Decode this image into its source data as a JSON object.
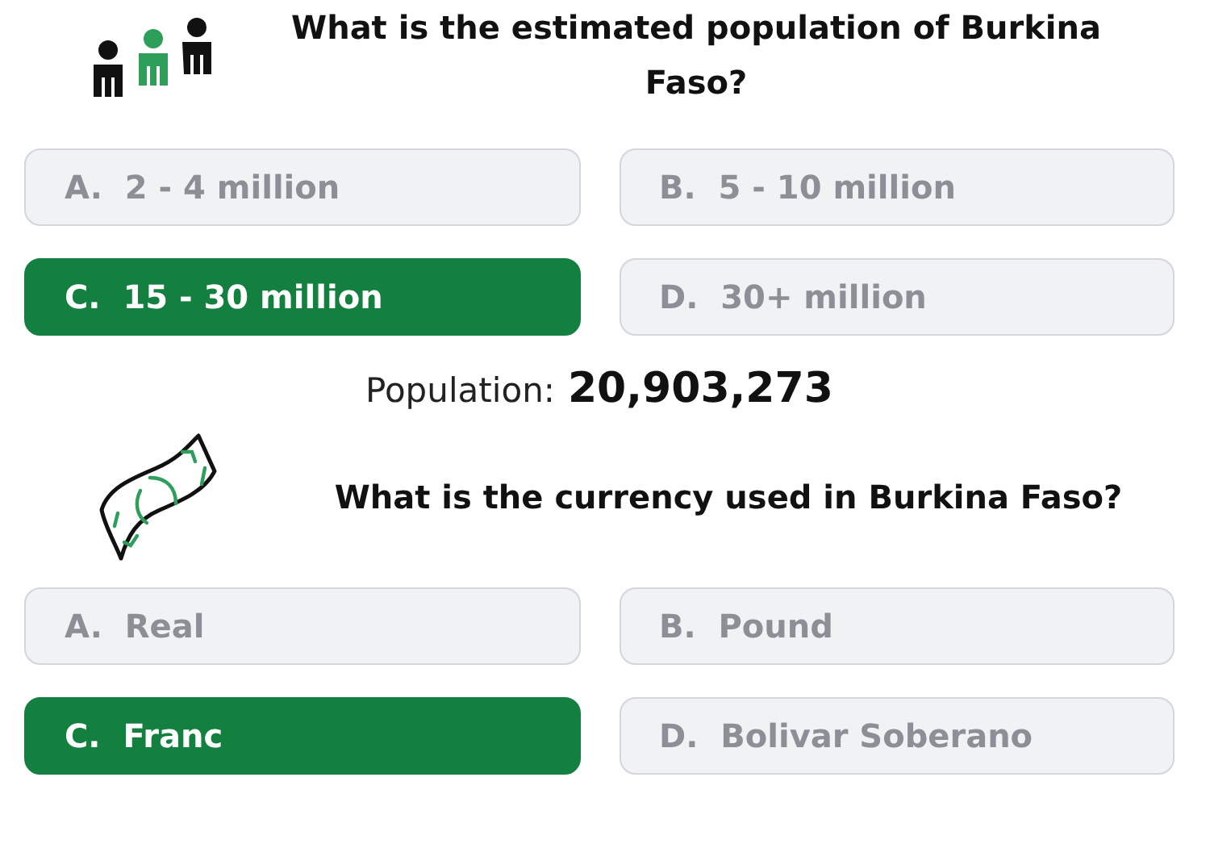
{
  "questions": [
    {
      "kind": "population",
      "question": "What is the estimated population of Burkina Faso?",
      "options": [
        {
          "letter": "A.",
          "text": "2 - 4 million",
          "selected": false
        },
        {
          "letter": "B.",
          "text": "5 - 10 million",
          "selected": false
        },
        {
          "letter": "C.",
          "text": "15 - 30 million",
          "selected": true
        },
        {
          "letter": "D.",
          "text": "30+ million",
          "selected": false
        }
      ],
      "result": {
        "label": "Population:",
        "value": "20,903,273"
      }
    },
    {
      "kind": "currency",
      "question": "What is the currency used in Burkina Faso?",
      "options": [
        {
          "letter": "A.",
          "text": "Real",
          "selected": false
        },
        {
          "letter": "B.",
          "text": "Pound",
          "selected": false
        },
        {
          "letter": "C.",
          "text": "Franc",
          "selected": true
        },
        {
          "letter": "D.",
          "text": "Bolivar Soberano",
          "selected": false
        }
      ]
    }
  ]
}
